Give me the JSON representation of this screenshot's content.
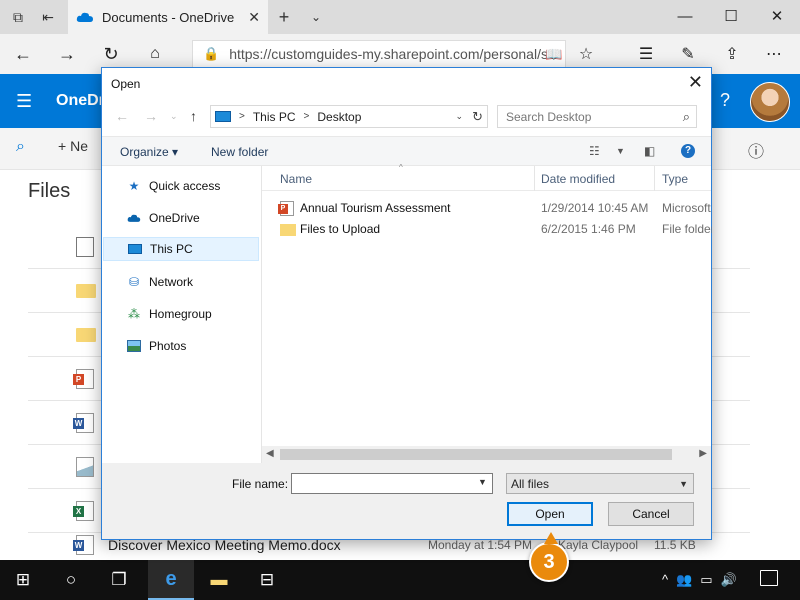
{
  "browser": {
    "tab_title": "Documents - OneDrive",
    "url": "https://customguides-my.sharepoint.com/personal/s",
    "window_controls": [
      "minimize",
      "maximize",
      "close"
    ]
  },
  "onedrive": {
    "brand": "OneDri",
    "help": "?",
    "new_label": "Ne",
    "files_title": "Files",
    "visible_row": {
      "name": "Discover Mexico Meeting Memo.docx",
      "modified": "Monday at 1:54 PM",
      "modified_by": "Kayla Claypool",
      "size": "11.5 KB"
    }
  },
  "dialog": {
    "title": "Open",
    "breadcrumb": [
      "This PC",
      "Desktop"
    ],
    "search_placeholder": "Search Desktop",
    "organize": "Organize ▾",
    "new_folder": "New folder",
    "nav_pane": [
      {
        "label": "Quick access",
        "icon": "star-icon",
        "selected": false
      },
      {
        "label": "OneDrive",
        "icon": "cloud-icon",
        "selected": false
      },
      {
        "label": "This PC",
        "icon": "computer-icon",
        "selected": true
      },
      {
        "label": "Network",
        "icon": "network-icon",
        "selected": false
      },
      {
        "label": "Homegroup",
        "icon": "homegroup-icon",
        "selected": false
      },
      {
        "label": "Photos",
        "icon": "photos-icon",
        "selected": false
      }
    ],
    "columns": [
      "Name",
      "Date modified",
      "Type"
    ],
    "files": [
      {
        "name": "Annual Tourism Assessment",
        "date": "1/29/2014 10:45 AM",
        "type": "Microsoft",
        "icon": "powerpoint-icon"
      },
      {
        "name": "Files to Upload",
        "date": "6/2/2015 1:46 PM",
        "type": "File folder",
        "icon": "folder-icon"
      }
    ],
    "file_name_label": "File name:",
    "file_name_value": "",
    "file_type": "All files",
    "open_button": "Open",
    "cancel_button": "Cancel"
  },
  "callout": "3",
  "colors": {
    "onedrive_blue": "#0078d7",
    "callout_orange": "#ea8a0c",
    "dialog_border": "#2b7fd8"
  }
}
